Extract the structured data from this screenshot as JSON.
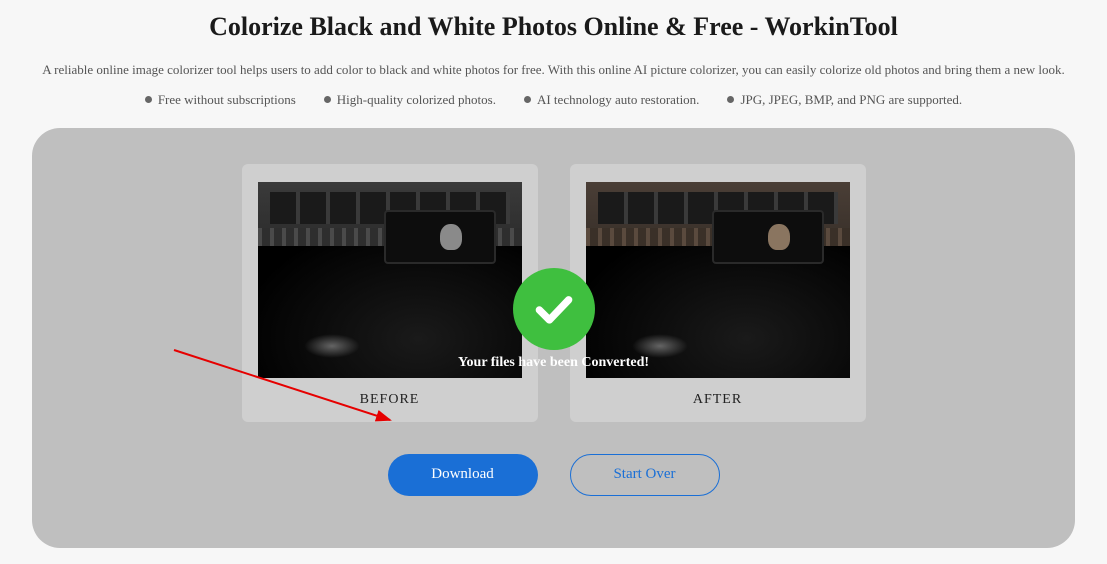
{
  "header": {
    "title": "Colorize Black and White Photos Online & Free - WorkinTool",
    "description": "A reliable online image colorizer tool helps users to add color to black and white photos for free. With this online AI picture colorizer, you can easily colorize old photos and bring them a new look.",
    "features": [
      "Free without subscriptions",
      "High-quality colorized photos.",
      "AI technology auto restoration.",
      "JPG, JPEG, BMP, and PNG are supported."
    ]
  },
  "compare": {
    "before_label": "BEFORE",
    "after_label": "AFTER"
  },
  "status": {
    "success_message": "Your files have been Converted!"
  },
  "buttons": {
    "download_label": "Download",
    "startover_label": "Start Over"
  }
}
